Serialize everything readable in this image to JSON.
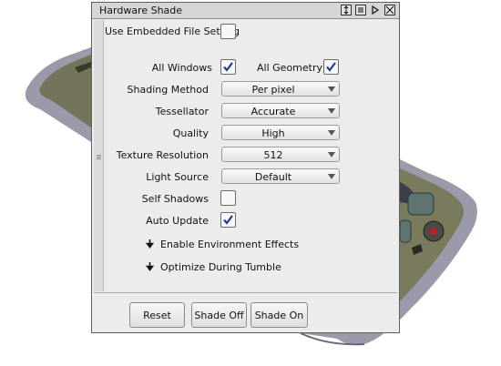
{
  "window": {
    "title": "Hardware Shade"
  },
  "options": {
    "use_embedded_label": "Use Embedded File Setting",
    "use_embedded_checked": false,
    "all_windows_label": "All Windows",
    "all_windows_checked": true,
    "all_geometry_label": "All Geometry",
    "all_geometry_checked": true
  },
  "fields": [
    {
      "label": "Shading Method",
      "value": "Per pixel"
    },
    {
      "label": "Tessellator",
      "value": "Accurate"
    },
    {
      "label": "Quality",
      "value": "High"
    },
    {
      "label": "Texture Resolution",
      "value": "512"
    },
    {
      "label": "Light Source",
      "value": "Default"
    }
  ],
  "toggles": {
    "self_shadows_label": "Self Shadows",
    "self_shadows_checked": false,
    "auto_update_label": "Auto Update",
    "auto_update_checked": true
  },
  "sections": [
    {
      "label": "Enable Environment Effects"
    },
    {
      "label": "Optimize During Tumble"
    }
  ],
  "buttons": {
    "reset": "Reset",
    "shade_off": "Shade Off",
    "shade_on": "Shade On"
  },
  "colors": {
    "check": "#1f3f8f",
    "phone_body": "#9b98aa",
    "phone_face": "#7a7b5c"
  }
}
